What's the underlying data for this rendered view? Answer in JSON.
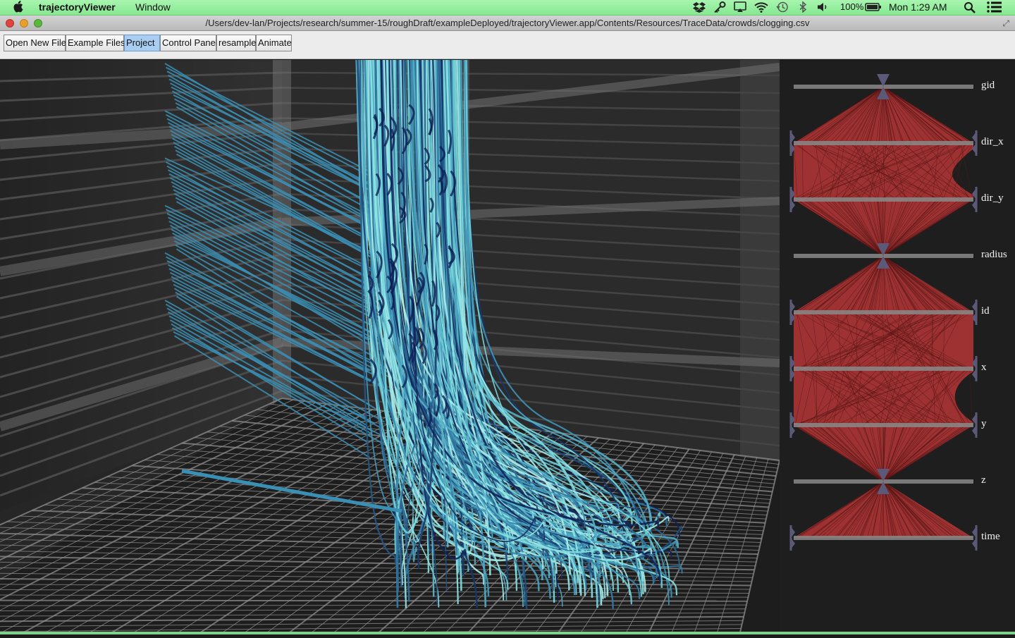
{
  "menubar": {
    "app_name": "trajectoryViewer",
    "menus": [
      "Window"
    ],
    "battery": "100%",
    "clock": "Mon 1:29 AM"
  },
  "window": {
    "title": "/Users/dev-lan/Projects/research/summer-15/roughDraft/exampleDeployed/trajectoryViewer.app/Contents/Resources/TraceData/crowds/clogging.csv"
  },
  "toolbar": {
    "buttons": [
      {
        "label": "Open New File",
        "active": false
      },
      {
        "label": "Example Files",
        "active": false
      },
      {
        "label": "Project",
        "active": true
      },
      {
        "label": "Control Panel",
        "active": false
      },
      {
        "label": "resample",
        "active": false
      },
      {
        "label": "Animate",
        "active": false
      }
    ]
  },
  "parallel_coordinates": {
    "axes": [
      "gid",
      "dir_x",
      "dir_y",
      "radius",
      "id",
      "x",
      "y",
      "z",
      "time"
    ],
    "colors": {
      "band_fill": "#9e3232",
      "axis_line": "#8a8a8a",
      "brush_handle": "#5a5a78",
      "label": "#f2f2f2"
    }
  },
  "viewport": {
    "colors": {
      "trajectory_light": "#7fe0e0",
      "trajectory_mid": "#3a8fb5",
      "trajectory_dark": "#0d1f55",
      "floor_grid": "#8c8c8c",
      "wall": "#2a2a2a"
    }
  }
}
